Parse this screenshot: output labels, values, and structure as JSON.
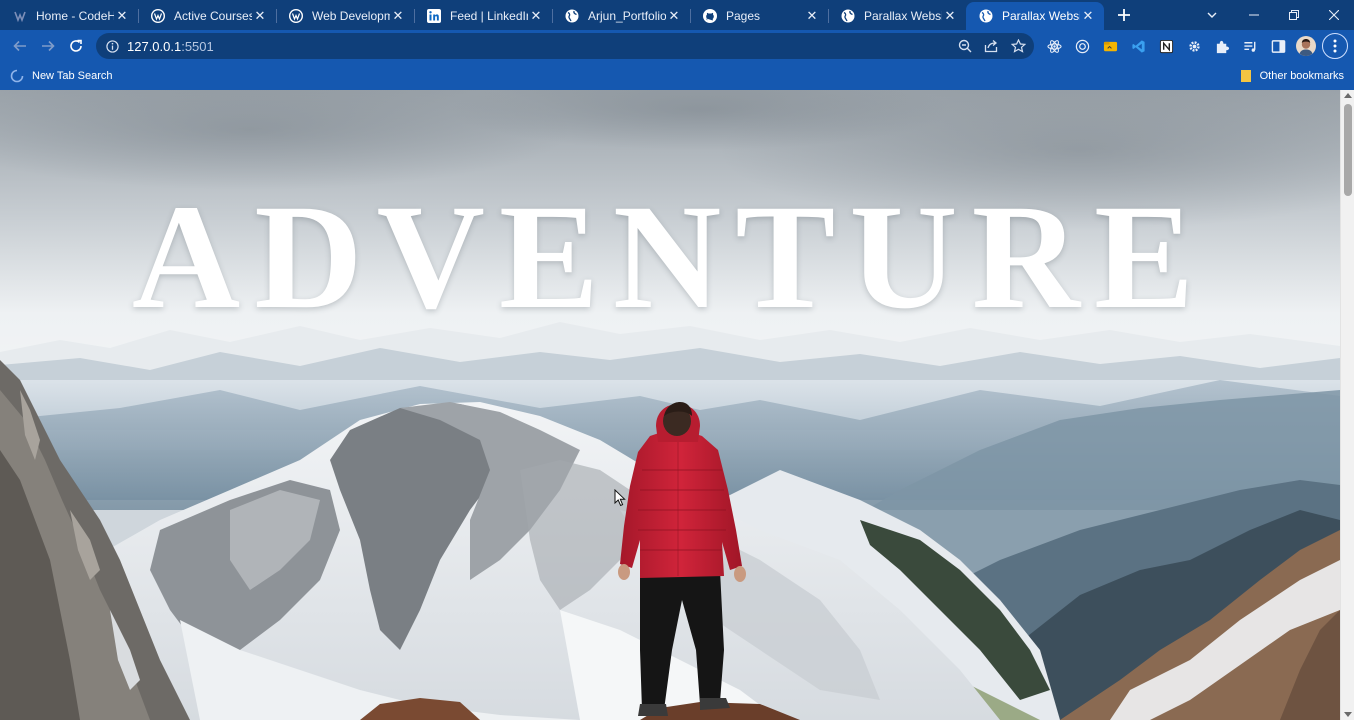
{
  "browser": {
    "tabs": [
      {
        "title": "Home - CodeHelp",
        "icon": "codehelp-icon",
        "active": false
      },
      {
        "title": "Active Courses",
        "icon": "wordpress-icon",
        "active": false
      },
      {
        "title": "Web Development",
        "icon": "wordpress-icon",
        "active": false
      },
      {
        "title": "Feed | LinkedIn",
        "icon": "linkedin-icon",
        "active": false
      },
      {
        "title": "Arjun_Portfolio",
        "icon": "globe-icon",
        "active": false
      },
      {
        "title": "Pages",
        "icon": "github-icon",
        "active": false
      },
      {
        "title": "Parallax Website",
        "icon": "globe-icon",
        "active": false
      },
      {
        "title": "Parallax Website",
        "icon": "globe-icon",
        "active": true
      }
    ],
    "url_host": "127.0.0.1",
    "url_port": ":5501",
    "bookmarks": {
      "left": "New Tab Search",
      "right": "Other bookmarks"
    },
    "colors": {
      "tabstrip": "#0f3f7a",
      "toolbar": "#1558b0"
    }
  },
  "page": {
    "hero_title": "ADVENTURE",
    "jacket_color": "#d0243a"
  }
}
